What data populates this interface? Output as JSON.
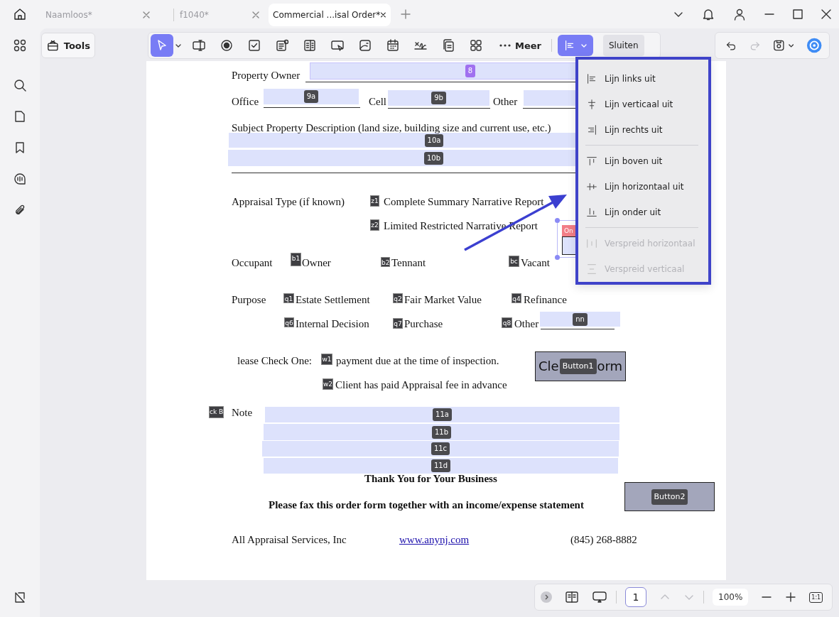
{
  "tabs": [
    {
      "label": "Naamloos*",
      "selected": false
    },
    {
      "label": "f1040*",
      "selected": false
    },
    {
      "label": "Commercial ...isal Order*",
      "selected": true
    }
  ],
  "tools_button": {
    "label": "Tools"
  },
  "toolbar": {
    "tools": [
      {
        "kind": "pointer",
        "selected": true
      },
      {
        "kind": "text-field",
        "selected": false
      },
      {
        "kind": "radio",
        "selected": false
      },
      {
        "kind": "checkbox",
        "selected": false
      },
      {
        "kind": "combo",
        "selected": false
      },
      {
        "kind": "list",
        "selected": false
      },
      {
        "kind": "ok-button",
        "selected": false
      },
      {
        "kind": "image",
        "selected": false
      },
      {
        "kind": "date",
        "selected": false
      },
      {
        "kind": "signature",
        "selected": false
      },
      {
        "kind": "copy",
        "selected": false
      },
      {
        "kind": "grid",
        "selected": false
      }
    ],
    "more_label": "Meer",
    "align_selected": true,
    "close_label": "Sluiten"
  },
  "history": {
    "undo_disabled": false,
    "redo_disabled": true
  },
  "align_menu": {
    "groups": [
      [
        {
          "kind": "align-left",
          "label": "Lijn links uit",
          "disabled": false
        },
        {
          "kind": "align-center",
          "label": "Lijn verticaal uit",
          "disabled": false
        },
        {
          "kind": "align-right",
          "label": "Lijn rechts uit",
          "disabled": false
        }
      ],
      [
        {
          "kind": "align-top",
          "label": "Lijn boven uit",
          "disabled": false
        },
        {
          "kind": "align-middle",
          "label": "Lijn horizontaal uit",
          "disabled": false
        },
        {
          "kind": "align-bottom",
          "label": "Lijn onder uit",
          "disabled": false
        }
      ],
      [
        {
          "kind": "distribute-h",
          "label": "Verspreid horizontaal",
          "disabled": true
        },
        {
          "kind": "distribute-v",
          "label": "Verspreid verticaal",
          "disabled": true
        }
      ]
    ]
  },
  "document": {
    "texts": [
      {
        "text": "Property Owner",
        "kind": "plain"
      },
      {
        "text": "Office",
        "kind": "plain"
      },
      {
        "text": "Cell",
        "kind": "plain"
      },
      {
        "text": "Other",
        "kind": "plain"
      },
      {
        "text": "Subject Property Description (land size, building size and current use, etc.)",
        "kind": "plain"
      },
      {
        "text": "Appraisal Type (if known)",
        "kind": "plain"
      },
      {
        "text": "Complete Summary Narrative Report",
        "kind": "plain"
      },
      {
        "text": "Limited Restricted Narrative Report",
        "kind": "plain"
      },
      {
        "text": "Occupant",
        "kind": "plain"
      },
      {
        "text": "Owner",
        "kind": "plain"
      },
      {
        "text": "Tennant",
        "kind": "plain"
      },
      {
        "text": "Vacant",
        "kind": "plain"
      },
      {
        "text": "Purpose",
        "kind": "plain"
      },
      {
        "text": "Estate Settlement",
        "kind": "plain"
      },
      {
        "text": "Fair Market Value",
        "kind": "plain"
      },
      {
        "text": "Refinance",
        "kind": "plain"
      },
      {
        "text": "Internal Decision",
        "kind": "plain"
      },
      {
        "text": "Purchase",
        "kind": "plain"
      },
      {
        "text": "Other",
        "kind": "plain"
      },
      {
        "text": "lease Check One:",
        "kind": "plain"
      },
      {
        "text": "payment due at the time of inspection.",
        "kind": "plain"
      },
      {
        "text": "Client has paid Appraisal fee in advance",
        "kind": "plain"
      },
      {
        "text": "Note",
        "kind": "plain"
      },
      {
        "text": "Thank You for Your Business",
        "kind": "bold"
      },
      {
        "text": "Please fax this order form together with an income/expense statement",
        "kind": "bold"
      },
      {
        "text": "All Appraisal Services, Inc",
        "kind": "plain"
      },
      {
        "text": "www.anynj.com",
        "kind": "link"
      },
      {
        "text": "(845) 268-8882",
        "kind": "plain"
      }
    ],
    "fields": [
      {
        "tag": "8",
        "kind": "field",
        "selected": true
      },
      {
        "tag": "9a",
        "kind": "field",
        "selected": false
      },
      {
        "tag": "9b",
        "kind": "field",
        "selected": false
      },
      {
        "kind": "field",
        "selected": false
      },
      {
        "tag": "10a",
        "kind": "field",
        "selected": false
      },
      {
        "tag": "10b",
        "kind": "field",
        "selected": false
      },
      {
        "tag": "z1",
        "kind": "check"
      },
      {
        "tag": "z2",
        "kind": "check"
      },
      {
        "tag": "b1",
        "kind": "check"
      },
      {
        "tag": "b2",
        "kind": "check"
      },
      {
        "tag": "bc",
        "kind": "check"
      },
      {
        "tag": "q1",
        "kind": "check"
      },
      {
        "tag": "q2",
        "kind": "check"
      },
      {
        "tag": "q4",
        "kind": "check"
      },
      {
        "tag": "q6",
        "kind": "check"
      },
      {
        "tag": "q7",
        "kind": "check"
      },
      {
        "tag": "q8",
        "kind": "check"
      },
      {
        "tag": "w1",
        "kind": "check"
      },
      {
        "tag": "w2",
        "kind": "check"
      },
      {
        "tag": "nn",
        "kind": "field",
        "selected": false
      },
      {
        "tag": "On",
        "kind": "flag",
        "selected": true
      },
      {
        "tag": "Button1",
        "kind": "button",
        "label": [
          "Cle",
          "orm"
        ]
      },
      {
        "tag": "ck B",
        "kind": "check"
      },
      {
        "tag": "11a",
        "kind": "field",
        "selected": false
      },
      {
        "tag": "11b",
        "kind": "field",
        "selected": false
      },
      {
        "tag": "11c",
        "kind": "field",
        "selected": false
      },
      {
        "tag": "11d",
        "kind": "field",
        "selected": false
      },
      {
        "tag": "Button2",
        "kind": "button"
      }
    ]
  },
  "page_control": {
    "page": "1",
    "previous_disabled": true,
    "next_disabled": true,
    "zoom": "100%",
    "actual_size": "1:1"
  }
}
